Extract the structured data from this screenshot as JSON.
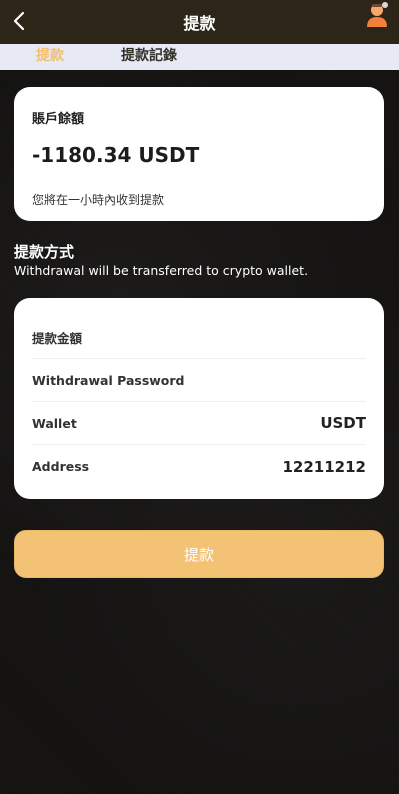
{
  "header": {
    "title": "提款",
    "back_icon": "chevron-left-icon",
    "avatar_icon": "user-avatar-icon"
  },
  "tabs": [
    {
      "label": "提款",
      "active": true
    },
    {
      "label": "提款記錄",
      "active": false
    }
  ],
  "balance": {
    "label": "賬戶餘額",
    "amount": "-1180.34 USDT",
    "note": "您將在一小時內收到提款"
  },
  "method": {
    "title": "提款方式",
    "description": "Withdrawal will be transferred to crypto wallet."
  },
  "form": {
    "amount_label": "提款金額",
    "password_label": "Withdrawal Password",
    "wallet_label": "Wallet",
    "wallet_value": "USDT",
    "address_label": "Address",
    "address_value": "12211212"
  },
  "submit": {
    "label": "提款"
  },
  "colors": {
    "header_bg": "#2e2519",
    "accent": "#f2c06e",
    "button_bg": "#f4c275",
    "tabs_bg": "#e7e9f5"
  }
}
